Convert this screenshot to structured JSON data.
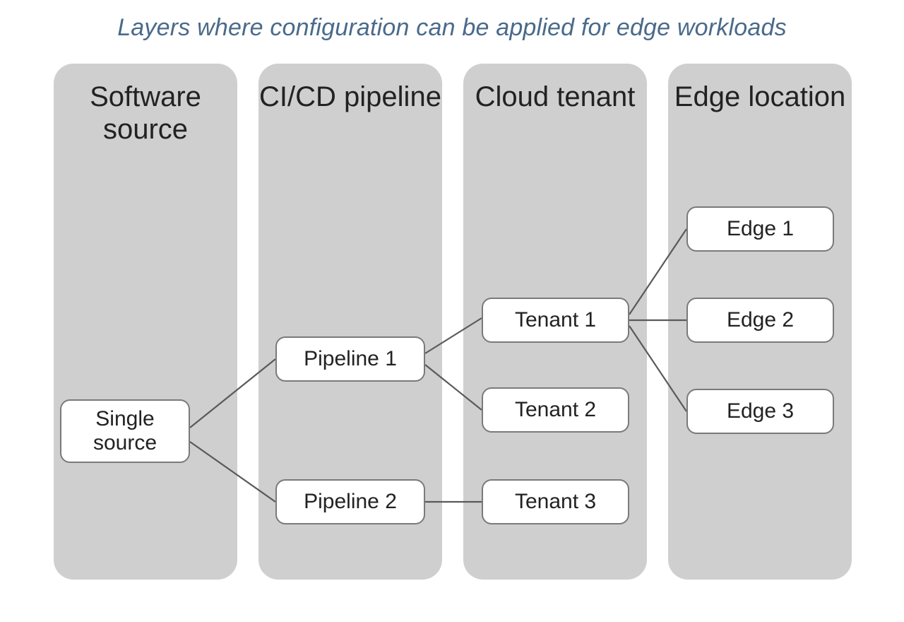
{
  "title": "Layers where configuration can be applied for edge workloads",
  "columns": {
    "c1": "Software source",
    "c2": "CI/CD pipeline",
    "c3": "Cloud tenant",
    "c4": "Edge location"
  },
  "nodes": {
    "source": "Single source",
    "pipeline1": "Pipeline 1",
    "pipeline2": "Pipeline 2",
    "tenant1": "Tenant 1",
    "tenant2": "Tenant 2",
    "tenant3": "Tenant 3",
    "edge1": "Edge 1",
    "edge2": "Edge 2",
    "edge3": "Edge 3"
  },
  "edges": [
    [
      "source",
      "pipeline1"
    ],
    [
      "source",
      "pipeline2"
    ],
    [
      "pipeline1",
      "tenant1"
    ],
    [
      "pipeline1",
      "tenant2"
    ],
    [
      "pipeline2",
      "tenant3"
    ],
    [
      "tenant1",
      "edge1"
    ],
    [
      "tenant1",
      "edge2"
    ],
    [
      "tenant1",
      "edge3"
    ]
  ]
}
